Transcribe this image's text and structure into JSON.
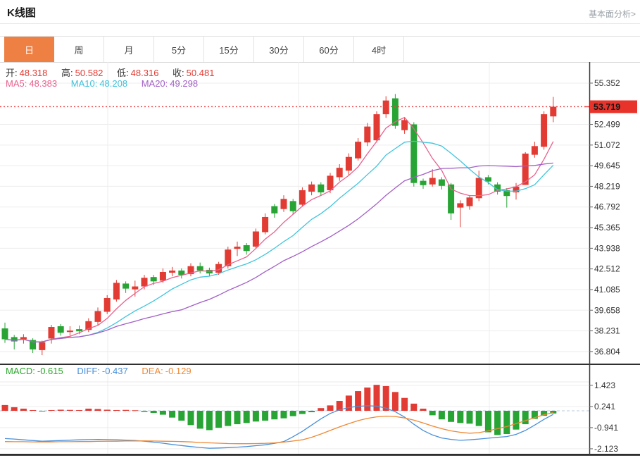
{
  "header": {
    "title": "K线图",
    "link": "基本面分析>"
  },
  "tabs": {
    "items": [
      "日",
      "周",
      "月",
      "5分",
      "15分",
      "30分",
      "60分",
      "4时"
    ],
    "selected_index": 0
  },
  "legend": {
    "ohlc": [
      {
        "label": "开:",
        "value": "48.318"
      },
      {
        "label": "高:",
        "value": "50.582"
      },
      {
        "label": "低:",
        "value": "48.316"
      },
      {
        "label": "收:",
        "value": "50.481"
      }
    ],
    "ma": [
      {
        "label": "MA5:",
        "value": "48.383"
      },
      {
        "label": "MA10:",
        "value": "48.208"
      },
      {
        "label": "MA20:",
        "value": "49.298"
      }
    ],
    "macd": [
      {
        "label": "MACD:",
        "value": "-0.615"
      },
      {
        "label": "DIFF:",
        "value": "-0.437"
      },
      {
        "label": "DEA:",
        "value": "-0.129"
      }
    ]
  },
  "chart_data": {
    "type": "candlestick_with_macd",
    "price_panel": {
      "ticks": [
        55.352,
        52.499,
        51.072,
        49.645,
        48.219,
        46.792,
        45.365,
        43.938,
        42.512,
        41.085,
        39.658,
        38.231,
        36.804
      ],
      "current_price": 53.719,
      "range": [
        35.97,
        56.81
      ],
      "grid": true
    },
    "candles": [
      [
        38.4,
        37.65,
        37.4,
        38.8
      ],
      [
        37.8,
        37.5,
        36.95,
        37.95
      ],
      [
        37.65,
        37.8,
        37.35,
        38.0
      ],
      [
        37.6,
        36.95,
        36.7,
        37.72
      ],
      [
        36.9,
        37.45,
        36.55,
        37.55
      ],
      [
        37.7,
        38.5,
        37.35,
        38.65
      ],
      [
        38.55,
        38.1,
        37.9,
        38.7
      ],
      [
        38.15,
        38.25,
        37.9,
        38.55
      ],
      [
        38.35,
        38.2,
        38.0,
        38.6
      ],
      [
        38.3,
        38.9,
        38.15,
        39.1
      ],
      [
        38.85,
        39.6,
        38.65,
        39.85
      ],
      [
        39.55,
        40.5,
        39.4,
        40.7
      ],
      [
        40.4,
        41.55,
        40.25,
        41.75
      ],
      [
        41.5,
        41.15,
        40.85,
        41.65
      ],
      [
        41.1,
        41.3,
        40.6,
        41.7
      ],
      [
        41.3,
        41.9,
        41.1,
        42.1
      ],
      [
        41.95,
        41.65,
        41.4,
        42.1
      ],
      [
        41.7,
        42.3,
        41.55,
        42.55
      ],
      [
        42.25,
        42.4,
        42.0,
        42.65
      ],
      [
        42.4,
        42.1,
        41.85,
        42.55
      ],
      [
        42.15,
        42.7,
        42.0,
        42.9
      ],
      [
        42.7,
        42.4,
        42.2,
        42.95
      ],
      [
        42.45,
        42.2,
        42.0,
        42.6
      ],
      [
        42.25,
        42.85,
        42.1,
        43.0
      ],
      [
        42.7,
        43.85,
        42.55,
        44.05
      ],
      [
        43.9,
        44.05,
        43.4,
        44.4
      ],
      [
        44.15,
        43.75,
        43.5,
        44.3
      ],
      [
        44.05,
        45.1,
        43.9,
        45.3
      ],
      [
        45.05,
        46.1,
        44.9,
        46.35
      ],
      [
        46.85,
        46.35,
        46.05,
        47.0
      ],
      [
        46.65,
        47.35,
        46.45,
        47.6
      ],
      [
        47.2,
        46.5,
        46.3,
        47.35
      ],
      [
        46.95,
        47.95,
        46.8,
        48.15
      ],
      [
        47.85,
        48.35,
        47.6,
        48.55
      ],
      [
        48.35,
        47.8,
        47.55,
        48.5
      ],
      [
        47.95,
        48.95,
        47.75,
        49.15
      ],
      [
        48.85,
        49.5,
        48.6,
        49.75
      ],
      [
        49.3,
        50.25,
        48.95,
        50.5
      ],
      [
        50.15,
        51.3,
        50.0,
        51.55
      ],
      [
        51.25,
        52.35,
        51.0,
        52.6
      ],
      [
        51.4,
        53.2,
        51.25,
        53.4
      ],
      [
        53.2,
        54.15,
        52.95,
        54.45
      ],
      [
        54.3,
        52.4,
        52.2,
        54.6
      ],
      [
        52.1,
        52.8,
        51.85,
        53.0
      ],
      [
        52.5,
        48.45,
        48.2,
        52.65
      ],
      [
        48.6,
        48.3,
        48.05,
        48.75
      ],
      [
        48.35,
        48.8,
        48.2,
        49.4
      ],
      [
        48.7,
        48.25,
        48.0,
        48.85
      ],
      [
        48.35,
        46.35,
        45.9,
        48.45
      ],
      [
        46.75,
        47.05,
        45.4,
        47.25
      ],
      [
        46.85,
        47.45,
        46.6,
        47.6
      ],
      [
        47.4,
        48.8,
        47.2,
        49.3
      ],
      [
        48.85,
        48.55,
        48.35,
        49.0
      ],
      [
        48.35,
        47.85,
        47.65,
        48.5
      ],
      [
        47.95,
        47.55,
        46.75,
        48.1
      ],
      [
        47.8,
        48.2,
        47.3,
        48.45
      ],
      [
        48.318,
        50.481,
        48.316,
        50.582
      ],
      [
        50.4,
        51.0,
        50.2,
        51.3
      ],
      [
        50.95,
        53.2,
        50.75,
        53.4
      ],
      [
        53.05,
        53.719,
        52.65,
        54.4
      ]
    ],
    "ma_periods": [
      5,
      10,
      20
    ],
    "macd_panel": {
      "ticks": [
        1.423,
        0.241,
        -0.941,
        -2.123
      ],
      "range": [
        -2.48,
        1.614
      ],
      "hist": [
        0.32,
        0.2,
        0.12,
        0.04,
        -0.03,
        0.04,
        0.06,
        0.05,
        0.04,
        0.12,
        0.1,
        0.06,
        0.04,
        0.05,
        0.03,
        -0.06,
        -0.12,
        -0.22,
        -0.38,
        -0.55,
        -0.8,
        -1.0,
        -1.08,
        -0.95,
        -0.85,
        -0.75,
        -0.68,
        -0.6,
        -0.55,
        -0.48,
        -0.42,
        -0.3,
        -0.18,
        -0.08,
        0.15,
        0.3,
        0.55,
        0.85,
        1.1,
        1.3,
        1.45,
        1.38,
        1.05,
        0.72,
        0.4,
        0.12,
        -0.25,
        -0.48,
        -0.62,
        -0.68,
        -0.72,
        -0.85,
        -1.2,
        -1.35,
        -1.3,
        -1.05,
        -0.75,
        -0.45,
        -0.28,
        -0.15
      ],
      "diff": [
        -1.55,
        -1.58,
        -1.62,
        -1.66,
        -1.7,
        -1.68,
        -1.66,
        -1.64,
        -1.62,
        -1.61,
        -1.6,
        -1.61,
        -1.62,
        -1.64,
        -1.66,
        -1.7,
        -1.75,
        -1.81,
        -1.88,
        -1.94,
        -2.0,
        -2.05,
        -2.09,
        -2.08,
        -2.06,
        -2.03,
        -2.0,
        -1.95,
        -1.9,
        -1.82,
        -1.72,
        -1.45,
        -1.15,
        -0.8,
        -0.45,
        -0.15,
        0.05,
        0.18,
        0.25,
        0.28,
        0.26,
        0.15,
        -0.05,
        -0.35,
        -0.75,
        -1.1,
        -1.35,
        -1.52,
        -1.6,
        -1.65,
        -1.62,
        -1.58,
        -1.53,
        -1.48,
        -1.44,
        -1.32,
        -1.1,
        -0.8,
        -0.48,
        -0.2
      ],
      "dea": [
        -1.72,
        -1.73,
        -1.73,
        -1.74,
        -1.74,
        -1.74,
        -1.73,
        -1.73,
        -1.72,
        -1.72,
        -1.71,
        -1.7,
        -1.7,
        -1.69,
        -1.69,
        -1.68,
        -1.69,
        -1.7,
        -1.71,
        -1.72,
        -1.74,
        -1.77,
        -1.79,
        -1.81,
        -1.83,
        -1.84,
        -1.84,
        -1.83,
        -1.82,
        -1.79,
        -1.75,
        -1.69,
        -1.62,
        -1.48,
        -1.3,
        -1.1,
        -0.9,
        -0.72,
        -0.55,
        -0.42,
        -0.34,
        -0.3,
        -0.32,
        -0.4,
        -0.52,
        -0.68,
        -0.85,
        -1.0,
        -1.12,
        -1.2,
        -1.25,
        -1.22,
        -1.12,
        -1.0,
        -0.88,
        -0.72,
        -0.55,
        -0.38,
        -0.22,
        -0.1
      ]
    },
    "colors": {
      "up": "#e23b34",
      "down": "#28a435",
      "ma5": "#e9618e",
      "ma10": "#41c5dd",
      "ma20": "#a35fc6",
      "diff": "#4a90d9",
      "dea": "#ef8833",
      "grid": "#ededed",
      "axis": "#3a3a3a",
      "tick_text": "#333333",
      "current_line": "#f03b3b",
      "tag_bg": "#e7332a",
      "tag_text": "#151515",
      "zero_dash": "#b9cbdc"
    }
  }
}
